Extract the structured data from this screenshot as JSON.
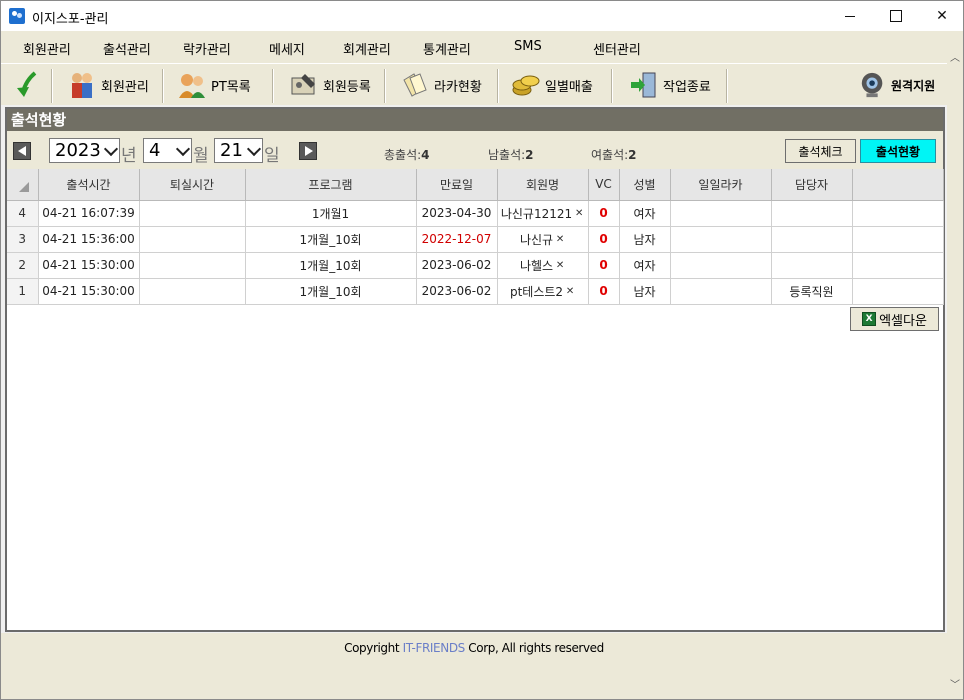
{
  "window": {
    "title": "이지스포-관리"
  },
  "menu": [
    "회원관리",
    "출석관리",
    "락카관리",
    "메세지",
    "회계관리",
    "통계관리",
    "SMS",
    "센터관리"
  ],
  "toolbar": {
    "buttons": [
      "회원관리",
      "PT목록",
      "회원등록",
      "라카현황",
      "일별매출",
      "작업종료"
    ],
    "remote_support": "원격지원"
  },
  "panel": {
    "title": "출석현황",
    "filters": {
      "year": "2023",
      "year_unit": "년",
      "month": "4",
      "month_unit": "월",
      "day": "21",
      "day_unit": "일"
    },
    "stats": {
      "total_label": "총출석",
      "total_value": "4",
      "male_label": "남출석",
      "male_value": "2",
      "female_label": "여출석",
      "female_value": "2"
    },
    "check_button": "출석체크",
    "status_button": "출석현황"
  },
  "grid": {
    "columns": [
      "출석시간",
      "퇴실시간",
      "프로그램",
      "만료일",
      "회원명",
      "VC",
      "성별",
      "일일라카",
      "담당자"
    ],
    "rows": [
      {
        "no": "4",
        "check_in": "04-21 16:07:39",
        "check_out": "",
        "program": "1개월1",
        "expiry": "2023-04-30",
        "expiry_overdue": false,
        "name": "나신규12121",
        "vc": "0",
        "gender": "여자",
        "locker": "",
        "staff": ""
      },
      {
        "no": "3",
        "check_in": "04-21 15:36:00",
        "check_out": "",
        "program": "1개월_10회",
        "expiry": "2022-12-07",
        "expiry_overdue": true,
        "name": "나신규",
        "vc": "0",
        "gender": "남자",
        "locker": "",
        "staff": ""
      },
      {
        "no": "2",
        "check_in": "04-21 15:30:00",
        "check_out": "",
        "program": "1개월_10회",
        "expiry": "2023-06-02",
        "expiry_overdue": false,
        "name": "나헬스",
        "vc": "0",
        "gender": "여자",
        "locker": "",
        "staff": ""
      },
      {
        "no": "1",
        "check_in": "04-21 15:30:00",
        "check_out": "",
        "program": "1개월_10회",
        "expiry": "2023-06-02",
        "expiry_overdue": false,
        "name": "pt테스트2",
        "vc": "0",
        "gender": "남자",
        "locker": "",
        "staff": "등록직원"
      }
    ]
  },
  "excel_button": "엑셀다운",
  "footer": {
    "prefix": "Copyright ",
    "brand": "IT-FRIENDS",
    "suffix": " Corp,  All rights reserved"
  },
  "colors": {
    "accent_cyan": "#00F5F5",
    "expired_red": "#D00000",
    "panel_header": "#716F64"
  }
}
